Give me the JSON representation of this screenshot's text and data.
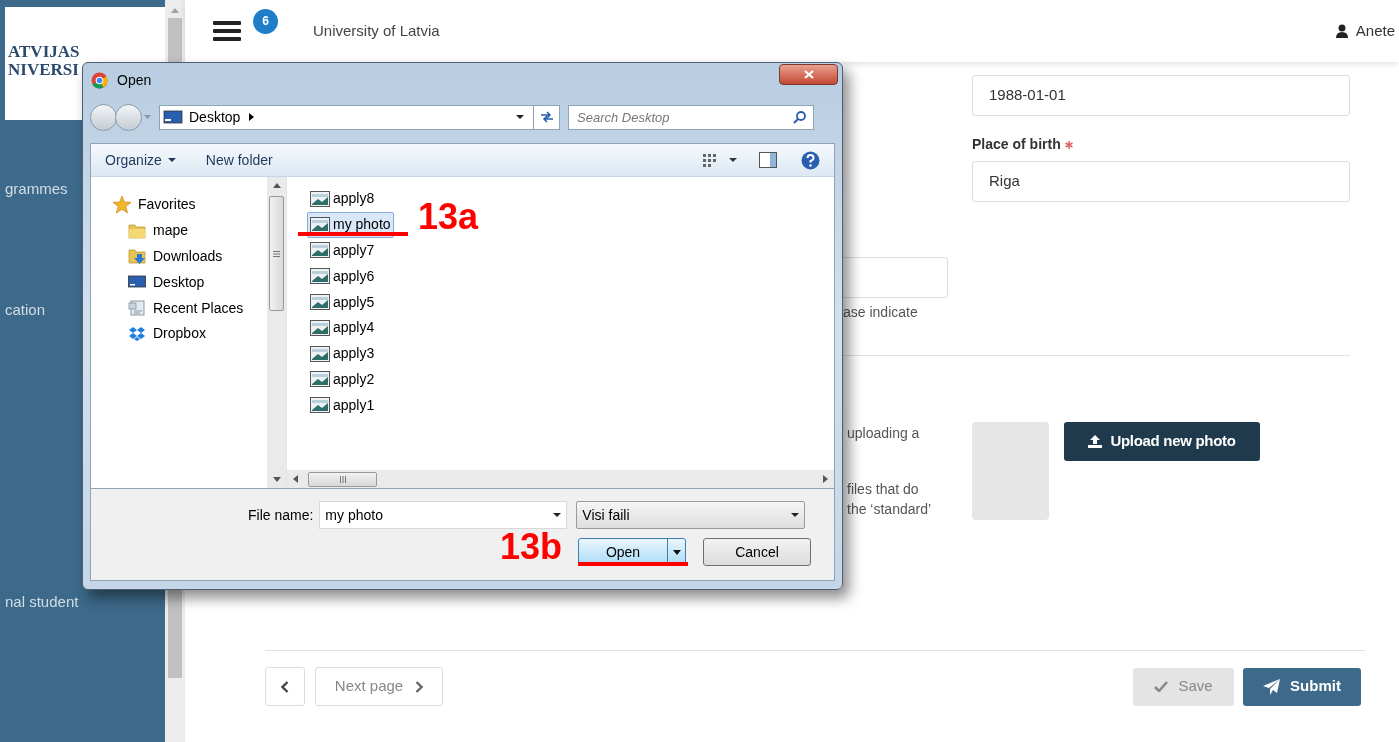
{
  "sidebar": {
    "logo_lines": [
      "ATVIJAS",
      "NIVERSI"
    ],
    "items": [
      {
        "label": "grammes"
      },
      {
        "label": "cation"
      },
      {
        "label": "nal student"
      }
    ]
  },
  "header": {
    "badge": "6",
    "title": "University of Latvia",
    "user": "Anete"
  },
  "form": {
    "date_value": "1988-01-01",
    "place_label": "Place of birth",
    "place_required": true,
    "place_value": "Riga",
    "fragments_top": [
      "ase indicate"
    ],
    "fragments_photo": [
      "uploading a",
      "files that do",
      "the ‘standard’"
    ],
    "upload_button": "Upload new photo"
  },
  "footer": {
    "next": "Next page",
    "save": {
      "label": "Save",
      "disabled": true
    },
    "submit": "Submit"
  },
  "dialog": {
    "title": "Open",
    "address": "Desktop",
    "search_placeholder": "Search Desktop",
    "toolbar": [
      "Organize",
      "New folder"
    ],
    "nav": [
      {
        "label": "Favorites",
        "kind": "favorites",
        "children": [
          {
            "label": "mape",
            "kind": "folder"
          },
          {
            "label": "Downloads",
            "kind": "downloads"
          },
          {
            "label": "Desktop",
            "kind": "desktop"
          },
          {
            "label": "Recent Places",
            "kind": "recent"
          },
          {
            "label": "Dropbox",
            "kind": "dropbox"
          }
        ]
      }
    ],
    "files": [
      {
        "name": "apply8",
        "selected": false
      },
      {
        "name": "my photo",
        "selected": true
      },
      {
        "name": "apply7",
        "selected": false
      },
      {
        "name": "apply6",
        "selected": false
      },
      {
        "name": "apply5",
        "selected": false
      },
      {
        "name": "apply4",
        "selected": false
      },
      {
        "name": "apply3",
        "selected": false
      },
      {
        "name": "apply2",
        "selected": false
      },
      {
        "name": "apply1",
        "selected": false
      }
    ],
    "file_name_label": "File name:",
    "file_name_value": "my photo",
    "filter": "Visi faili",
    "buttons": [
      {
        "label": "Open",
        "kind": "split",
        "focused": true
      },
      {
        "label": "Cancel",
        "kind": "plain",
        "focused": false
      }
    ]
  },
  "annotations": [
    {
      "label": "13a"
    },
    {
      "label": "13b"
    }
  ]
}
